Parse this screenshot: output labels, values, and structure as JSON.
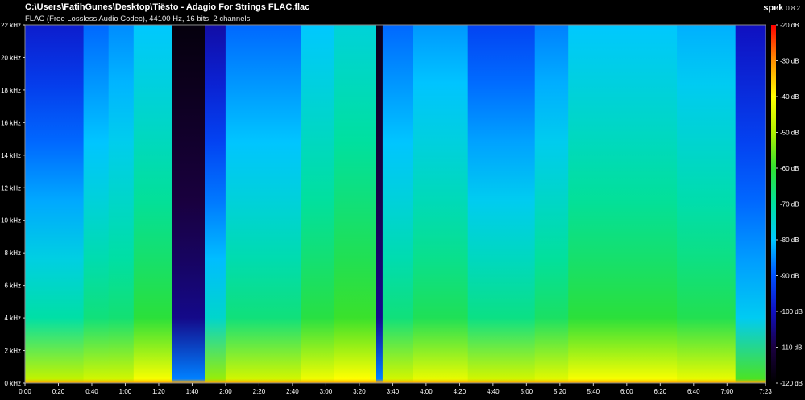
{
  "header": {
    "file_path": "C:\\Users\\FatihGunes\\Desktop\\Tiësto - Adagio For Strings FLAC.flac",
    "stream_info": "FLAC (Free Lossless Audio Codec), 44100 Hz, 16 bits, 2 channels",
    "app_name": "spek",
    "app_version": "0.8.2"
  },
  "chart_data": {
    "type": "heatmap",
    "title": "",
    "xlabel": "",
    "ylabel": "",
    "x_unit": "time (m:ss)",
    "y_unit": "kHz",
    "xlim_seconds": [
      0,
      443
    ],
    "ylim_khz": [
      0,
      22
    ],
    "x_ticks": [
      "0:00",
      "0:20",
      "0:40",
      "1:00",
      "1:20",
      "1:40",
      "2:00",
      "2:20",
      "2:40",
      "3:00",
      "3:20",
      "3:40",
      "4:00",
      "4:20",
      "4:40",
      "5:00",
      "5:20",
      "5:40",
      "6:00",
      "6:20",
      "6:40",
      "7:00",
      "7:23"
    ],
    "y_ticks": [
      "0 kHz",
      "2 kHz",
      "4 kHz",
      "6 kHz",
      "8 kHz",
      "10 kHz",
      "12 kHz",
      "14 kHz",
      "16 kHz",
      "18 kHz",
      "20 kHz",
      "22 kHz"
    ],
    "colorbar": {
      "range_db": [
        -120,
        -20
      ],
      "ticks": [
        "-20 dB",
        "-30 dB",
        "-40 dB",
        "-50 dB",
        "-60 dB",
        "-70 dB",
        "-80 dB",
        "-90 dB",
        "-100 dB",
        "-110 dB",
        "-120 dB"
      ],
      "palette": [
        "#000000",
        "#1a0040",
        "#1010c0",
        "#0050ff",
        "#00c8ff",
        "#00e0a0",
        "#30e030",
        "#b0f000",
        "#ffff00",
        "#ff9000",
        "#ff0000"
      ]
    },
    "segments_note_units": "start/end in seconds; db_low at 0 kHz, db_high at 22 kHz",
    "segments": [
      {
        "start": 0,
        "end": 35,
        "db_low": -62,
        "db_high": -98
      },
      {
        "start": 35,
        "end": 50,
        "db_low": -60,
        "db_high": -88
      },
      {
        "start": 50,
        "end": 65,
        "db_low": -60,
        "db_high": -85
      },
      {
        "start": 65,
        "end": 88,
        "db_low": -55,
        "db_high": -80
      },
      {
        "start": 88,
        "end": 108,
        "db_low": -100,
        "db_high": -118
      },
      {
        "start": 108,
        "end": 120,
        "db_low": -66,
        "db_high": -102
      },
      {
        "start": 120,
        "end": 165,
        "db_low": -60,
        "db_high": -88
      },
      {
        "start": 165,
        "end": 185,
        "db_low": -56,
        "db_high": -80
      },
      {
        "start": 185,
        "end": 210,
        "db_low": -54,
        "db_high": -76
      },
      {
        "start": 210,
        "end": 214,
        "db_low": -100,
        "db_high": -116
      },
      {
        "start": 214,
        "end": 232,
        "db_low": -60,
        "db_high": -88
      },
      {
        "start": 232,
        "end": 265,
        "db_low": -57,
        "db_high": -84
      },
      {
        "start": 265,
        "end": 305,
        "db_low": -60,
        "db_high": -92
      },
      {
        "start": 305,
        "end": 325,
        "db_low": -58,
        "db_high": -86
      },
      {
        "start": 325,
        "end": 390,
        "db_low": -55,
        "db_high": -80
      },
      {
        "start": 390,
        "end": 425,
        "db_low": -57,
        "db_high": -82
      },
      {
        "start": 425,
        "end": 443,
        "db_low": -72,
        "db_high": -100
      }
    ]
  }
}
